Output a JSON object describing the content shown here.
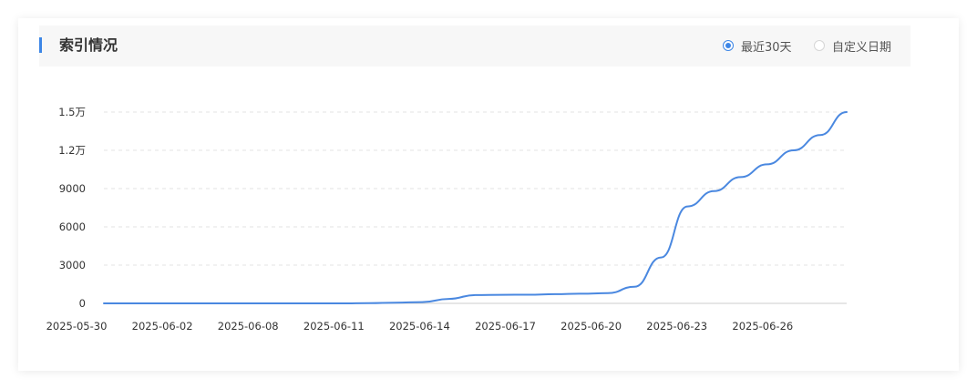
{
  "header": {
    "title": "索引情况",
    "range_options": [
      {
        "label": "最近30天",
        "selected": true
      },
      {
        "label": "自定义日期",
        "selected": false
      }
    ]
  },
  "colors": {
    "accent": "#3d86e6",
    "line": "#4a88e0",
    "grid": "#e3e3e3"
  },
  "chart_data": {
    "type": "line",
    "title": "",
    "xlabel": "",
    "ylabel": "",
    "ylim": [
      0,
      15000
    ],
    "y_ticks": [
      {
        "value": 0,
        "label": "0"
      },
      {
        "value": 3000,
        "label": "3000"
      },
      {
        "value": 6000,
        "label": "6000"
      },
      {
        "value": 9000,
        "label": "9000"
      },
      {
        "value": 12000,
        "label": "1.2万"
      },
      {
        "value": 15000,
        "label": "1.5万"
      }
    ],
    "x_tick_labels": [
      "2025-05-30",
      "2025-06-02",
      "2025-06-08",
      "2025-06-11",
      "2025-06-14",
      "2025-06-17",
      "2025-06-20",
      "2025-06-23",
      "2025-06-26"
    ],
    "grid": true,
    "legend": "none",
    "series": [
      {
        "values": [
          0,
          0,
          0,
          0,
          0,
          0,
          0,
          0,
          0,
          0,
          20,
          60,
          100,
          350,
          650,
          670,
          680,
          720,
          760,
          800,
          1300,
          3600,
          7600,
          8800,
          9900,
          10900,
          12000,
          13200,
          15000
        ]
      }
    ]
  }
}
